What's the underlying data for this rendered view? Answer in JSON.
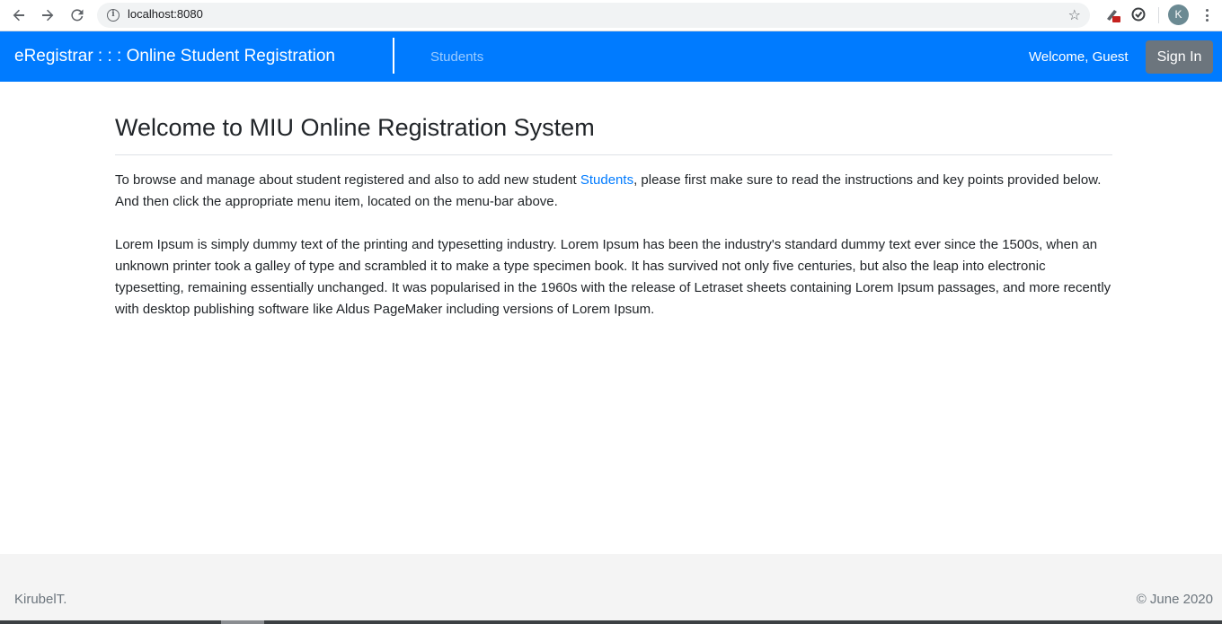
{
  "browser": {
    "url": "localhost:8080",
    "avatar_letter": "K",
    "icons": {
      "back": "arrow-left-icon",
      "forward": "arrow-right-icon",
      "reload": "reload-icon",
      "info": "info-icon",
      "bookmark": "star-icon",
      "extension1": "extension-icon",
      "extension2": "sync-icon",
      "menu": "kebab-menu-icon"
    }
  },
  "navbar": {
    "brand": "eRegistrar : : : Online Student Registration",
    "links": [
      {
        "label": "Students"
      }
    ],
    "welcome": "Welcome, Guest",
    "signin_label": "Sign In",
    "colors": {
      "background": "#007bff",
      "signin": "#6c757d"
    }
  },
  "main": {
    "title": "Welcome to MIU Online Registration System",
    "intro_before_link": "To browse and manage about student registered and also to add new student ",
    "intro_link": "Students",
    "intro_after_link": ", please first make sure to read the instructions and key points provided below. And then click the appropriate menu item, located on the menu-bar above.",
    "lorem": "Lorem Ipsum is simply dummy text of the printing and typesetting industry. Lorem Ipsum has been the industry's standard dummy text ever since the 1500s, when an unknown printer took a galley of type and scrambled it to make a type specimen book. It has survived not only five centuries, but also the leap into electronic typesetting, remaining essentially unchanged. It was popularised in the 1960s with the release of Letraset sheets containing Lorem Ipsum passages, and more recently with desktop publishing software like Aldus PageMaker including versions of Lorem Ipsum."
  },
  "footer": {
    "author": "KirubelT.",
    "copyright": "© June 2020"
  }
}
